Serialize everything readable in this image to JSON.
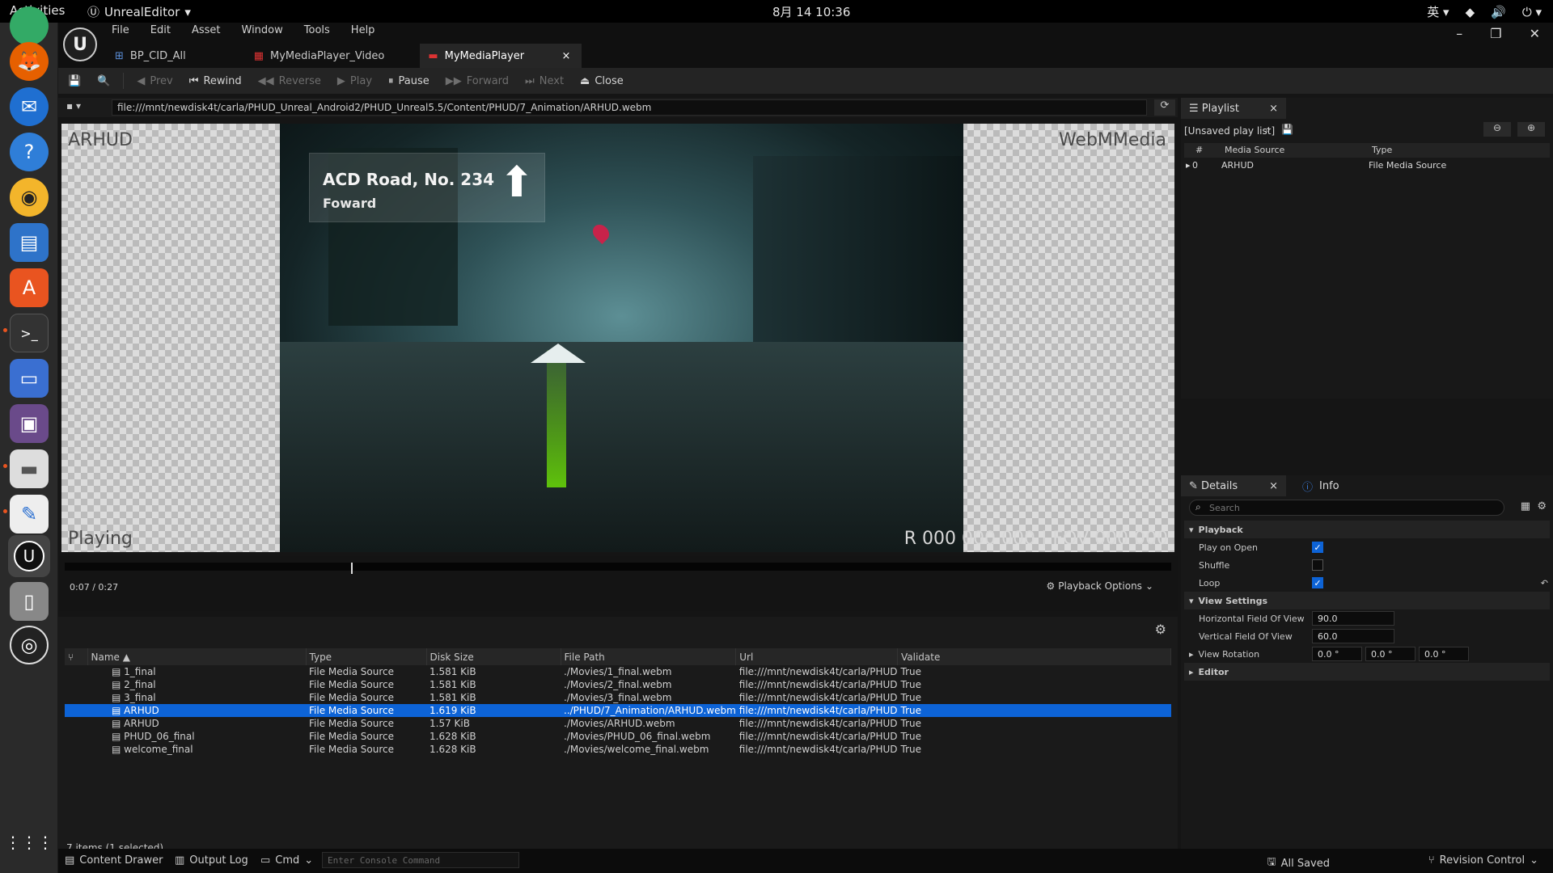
{
  "os": {
    "activities": "Activities",
    "app_name": "UnrealEditor",
    "clock": "8月 14  10:36",
    "input_method": "英"
  },
  "menu": [
    "File",
    "Edit",
    "Asset",
    "Window",
    "Tools",
    "Help"
  ],
  "tabs": [
    {
      "label": "BP_CID_All"
    },
    {
      "label": "MyMediaPlayer_Video"
    },
    {
      "label": "MyMediaPlayer"
    }
  ],
  "toolbar": {
    "prev": "Prev",
    "rewind": "Rewind",
    "reverse": "Reverse",
    "play": "Play",
    "pause": "Pause",
    "forward": "Forward",
    "next": "Next",
    "close": "Close"
  },
  "url": "file:///mnt/newdisk4t/carla/PHUD_Unreal_Android2/PHUD_Unreal5.5/Content/PHUD/7_Animation/ARHUD.webm",
  "viewer": {
    "top_left": "ARHUD",
    "top_right": "WebMMedia",
    "bottom_left": "Playing",
    "bottom_right": "R 000 000 000 | FOV 000 000",
    "sign_title": "ACD Road, No. 234",
    "sign_sub": "Foward"
  },
  "timeline": {
    "time": "0:07 / 0:27",
    "progress": 0.259,
    "playback_options": "Playback Options"
  },
  "list": {
    "columns": [
      "Name",
      "Type",
      "Disk Size",
      "File Path",
      "Url",
      "Validate"
    ],
    "rows": [
      {
        "name": "1_final",
        "type": "File Media Source",
        "size": "1.581 KiB",
        "path": "./Movies/1_final.webm",
        "url": "file:///mnt/newdisk4t/carla/PHUD",
        "valid": "True"
      },
      {
        "name": "2_final",
        "type": "File Media Source",
        "size": "1.581 KiB",
        "path": "./Movies/2_final.webm",
        "url": "file:///mnt/newdisk4t/carla/PHUD",
        "valid": "True"
      },
      {
        "name": "3_final",
        "type": "File Media Source",
        "size": "1.581 KiB",
        "path": "./Movies/3_final.webm",
        "url": "file:///mnt/newdisk4t/carla/PHUD",
        "valid": "True"
      },
      {
        "name": "ARHUD",
        "type": "File Media Source",
        "size": "1.619 KiB",
        "path": "../PHUD/7_Animation/ARHUD.webm",
        "url": "file:///mnt/newdisk4t/carla/PHUD",
        "valid": "True"
      },
      {
        "name": "ARHUD",
        "type": "File Media Source",
        "size": "1.57 KiB",
        "path": "./Movies/ARHUD.webm",
        "url": "file:///mnt/newdisk4t/carla/PHUD",
        "valid": "True"
      },
      {
        "name": "PHUD_06_final",
        "type": "File Media Source",
        "size": "1.628 KiB",
        "path": "./Movies/PHUD_06_final.webm",
        "url": "file:///mnt/newdisk4t/carla/PHUD",
        "valid": "True"
      },
      {
        "name": "welcome_final",
        "type": "File Media Source",
        "size": "1.628 KiB",
        "path": "./Movies/welcome_final.webm",
        "url": "file:///mnt/newdisk4t/carla/PHUD",
        "valid": "True"
      }
    ],
    "footer": "7 items (1 selected)"
  },
  "playlist": {
    "tab": "Playlist",
    "name": "[Unsaved play list]",
    "col_index": "#",
    "col_source": "Media Source",
    "col_type": "Type",
    "row_index": "0",
    "row_source": "ARHUD",
    "row_type": "File Media Source"
  },
  "details": {
    "tab": "Details",
    "info_tab": "Info",
    "search_placeholder": "Search",
    "playback": "Playback",
    "play_on_open": "Play on Open",
    "shuffle": "Shuffle",
    "loop": "Loop",
    "view_settings": "View Settings",
    "hfov_label": "Horizontal Field Of View",
    "hfov": "90.0",
    "vfov_label": "Vertical Field Of View",
    "vfov": "60.0",
    "view_rotation": "View Rotation",
    "rot_x": "0.0 °",
    "rot_y": "0.0 °",
    "rot_z": "0.0 °",
    "editor": "Editor"
  },
  "status": {
    "content_drawer": "Content Drawer",
    "output_log": "Output Log",
    "cmd": "Cmd",
    "console_placeholder": "Enter Console Command",
    "all_saved": "All Saved",
    "revision": "Revision Control"
  }
}
